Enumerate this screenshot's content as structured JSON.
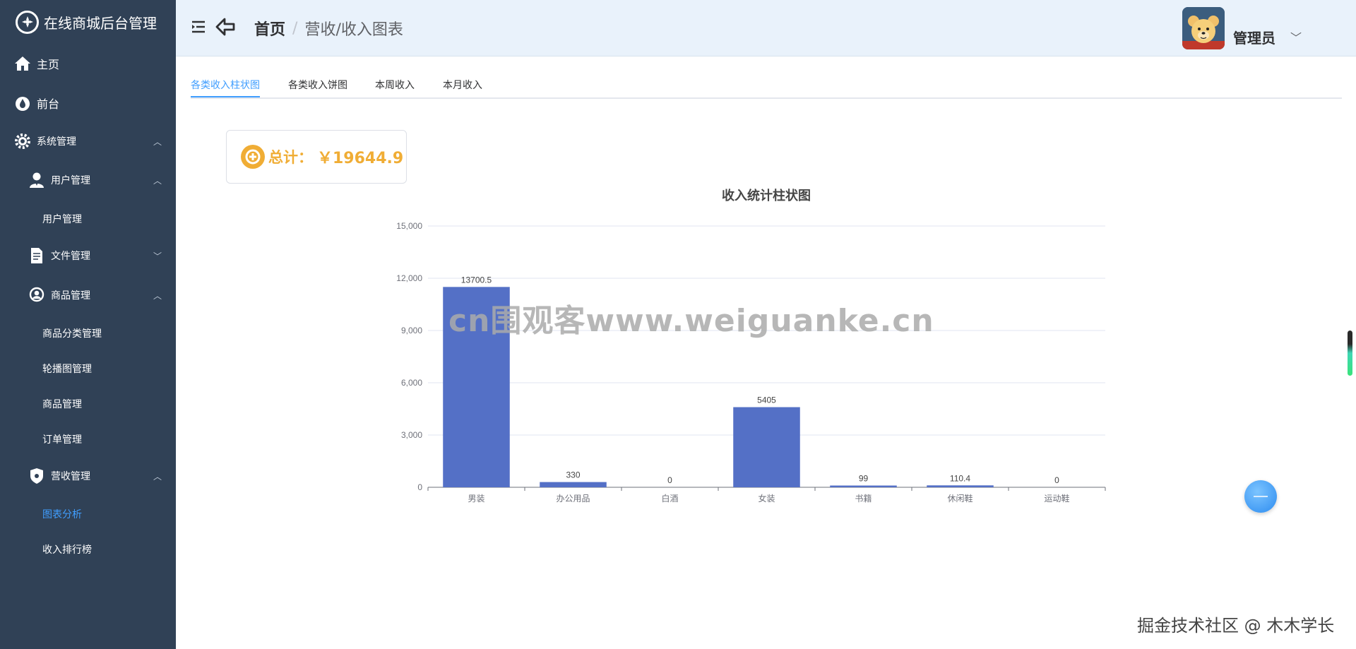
{
  "app": {
    "title": "在线商城后台管理"
  },
  "sidebar": {
    "items": [
      {
        "label": "主页",
        "icon": "home-icon"
      },
      {
        "label": "前台",
        "icon": "drop-icon"
      },
      {
        "label": "系统管理",
        "icon": "gear-icon",
        "arrow": "︿"
      },
      {
        "label": "用户管理",
        "icon": "user-icon",
        "arrow": "︿"
      },
      {
        "label": "用户管理"
      },
      {
        "label": "文件管理",
        "icon": "document-icon",
        "arrow": "﹀"
      },
      {
        "label": "商品管理",
        "icon": "search-icon",
        "arrow": "︿"
      },
      {
        "label": "商品分类管理"
      },
      {
        "label": "轮播图管理"
      },
      {
        "label": "商品管理"
      },
      {
        "label": "订单管理"
      },
      {
        "label": "营收管理",
        "icon": "shield-icon",
        "arrow": "︿"
      },
      {
        "label": "图表分析",
        "active": true
      },
      {
        "label": "收入排行榜"
      }
    ]
  },
  "header": {
    "breadcrumb_home": "首页",
    "breadcrumb_sep": "/",
    "breadcrumb_current": "营收/收入图表",
    "user_name": "管理员",
    "caret": "﹀"
  },
  "tabs": [
    {
      "label": "各类收入柱状图",
      "active": true
    },
    {
      "label": "各类收入饼图"
    },
    {
      "label": "本周收入"
    },
    {
      "label": "本月收入"
    }
  ],
  "total": {
    "label": "总计：",
    "value": "￥19644.9"
  },
  "chart_data": {
    "type": "bar",
    "title": "收入统计柱状图",
    "categories": [
      "男装",
      "办公用品",
      "白酒",
      "女装",
      "书籍",
      "休闲鞋",
      "运动鞋"
    ],
    "values": [
      11500,
      300,
      0,
      4600,
      100,
      110,
      0
    ],
    "data_labels": [
      "13700.5",
      "330",
      "0",
      "5405",
      "99",
      "110.4",
      "0"
    ],
    "ylim": [
      0,
      15000
    ],
    "yticks": [
      "0",
      "3,000",
      "6,000",
      "9,000",
      "12,000",
      "15,000"
    ],
    "ytick_values": [
      0,
      3000,
      6000,
      9000,
      12000,
      15000
    ],
    "grid": true,
    "color": "#5470c6"
  },
  "watermark": "cn围观客www.weiguanke.cn",
  "footer_credit": "掘金技术社区 @ 木木学长"
}
